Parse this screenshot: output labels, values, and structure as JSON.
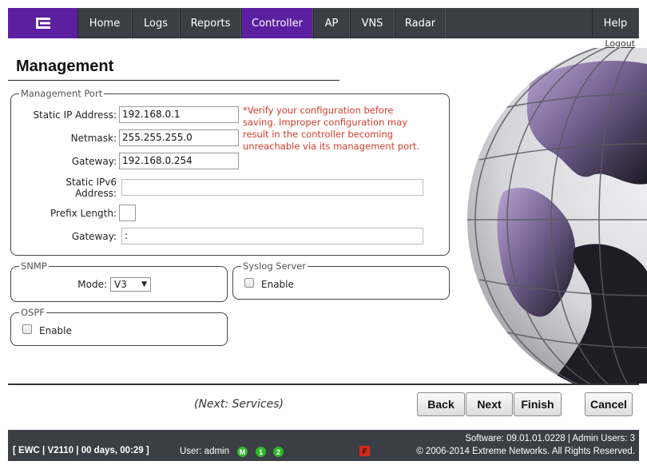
{
  "nav": {
    "logo_icon": "extreme-networks-logo",
    "items": [
      {
        "label": "Home"
      },
      {
        "label": "Logs"
      },
      {
        "label": "Reports"
      },
      {
        "label": "Controller",
        "active": true
      },
      {
        "label": "AP"
      },
      {
        "label": "VNS"
      },
      {
        "label": "Radar"
      }
    ],
    "help": "Help",
    "logout": "Logout",
    "accent_color": "#5b1fa0"
  },
  "page": {
    "title": "Management"
  },
  "management_port": {
    "legend": "Management Port",
    "static_ip_label": "Static IP Address:",
    "static_ip_value": "192.168.0.1",
    "netmask_label": "Netmask:",
    "netmask_value": "255.255.255.0",
    "gateway_label": "Gateway:",
    "gateway_value": "192.168.0.254",
    "ipv6_label_line1": "Static IPv6",
    "ipv6_label_line2": "Address:",
    "ipv6_value": "",
    "prefix_label": "Prefix Length:",
    "prefix_value": "",
    "gateway6_label": "Gateway:",
    "gateway6_value": ":",
    "warning_line1": "*Verify your configuration before",
    "warning_line2": "saving. Improper configuration may",
    "warning_line3": "result in the controller becoming",
    "warning_line4": "unreachable via its management port.",
    "warning_color": "#d43c2a"
  },
  "snmp": {
    "legend": "SNMP",
    "mode_label": "Mode:",
    "mode_value": "V3"
  },
  "syslog": {
    "legend": "Syslog Server",
    "enable_label": "Enable"
  },
  "ospf": {
    "legend": "OSPF",
    "enable_label": "Enable"
  },
  "footer": {
    "next_hint": "(Next: Services)",
    "back": "Back",
    "next": "Next",
    "finish": "Finish",
    "cancel": "Cancel"
  },
  "status": {
    "system": "[ EWC | V2110 | 00 days, 00:29 ]",
    "user": "User: admin",
    "badges": [
      "M",
      "1",
      "2"
    ],
    "fault_badge": "F",
    "software": "Software: 09.01.01.0228 | Admin Users: 3",
    "copyright": "© 2006-2014  Extreme Networks. All Rights Reserved."
  }
}
